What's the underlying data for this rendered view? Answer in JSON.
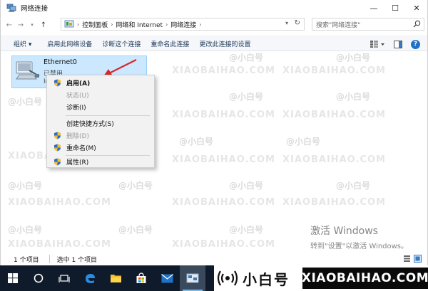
{
  "window": {
    "title": "网络连接",
    "controls": {
      "minimize": "—",
      "maximize": "☐",
      "close": "✕"
    }
  },
  "address": {
    "breadcrumbs": [
      "控制面板",
      "网络和 Internet",
      "网络连接"
    ],
    "search_placeholder": "搜索\"网络连接\""
  },
  "toolbar": {
    "items": [
      "组织 ▾",
      "启用此网络设备",
      "诊断这个连接",
      "重命名此连接",
      "更改此连接的设置"
    ]
  },
  "adapter": {
    "name": "Ethernet0",
    "status": "已禁用",
    "device": "In"
  },
  "context_menu": {
    "items": [
      {
        "label": "启用(A)",
        "bold": true,
        "disabled": false,
        "icon": "shield-icon"
      },
      {
        "label": "状态(U)",
        "bold": false,
        "disabled": true,
        "icon": ""
      },
      {
        "label": "诊断(I)",
        "bold": false,
        "disabled": false,
        "icon": ""
      },
      {
        "label": "创建快捷方式(S)",
        "bold": false,
        "disabled": false,
        "icon": ""
      },
      {
        "label": "删除(D)",
        "bold": false,
        "disabled": true,
        "icon": "shield-icon"
      },
      {
        "label": "重命名(M)",
        "bold": false,
        "disabled": false,
        "icon": "shield-icon"
      },
      {
        "label": "属性(R)",
        "bold": false,
        "disabled": false,
        "icon": "shield-icon"
      }
    ]
  },
  "activation": {
    "line1": "激活 Windows",
    "line2": "转到\"设置\"以激活 Windows。"
  },
  "statusbar": {
    "count": "1 个项目",
    "selected": "选中 1 个项目"
  },
  "watermark": {
    "cn": "@小白号",
    "en": "XIAOBAIHAO.COM"
  },
  "brand": {
    "cn": "小白号",
    "en": "XIAOBAIHAO.COM"
  },
  "colors": {
    "selection": "#cce8ff",
    "toolbar_text": "#1e3958",
    "taskbar": "#0f1a2a",
    "arrow": "#d62a2a"
  }
}
